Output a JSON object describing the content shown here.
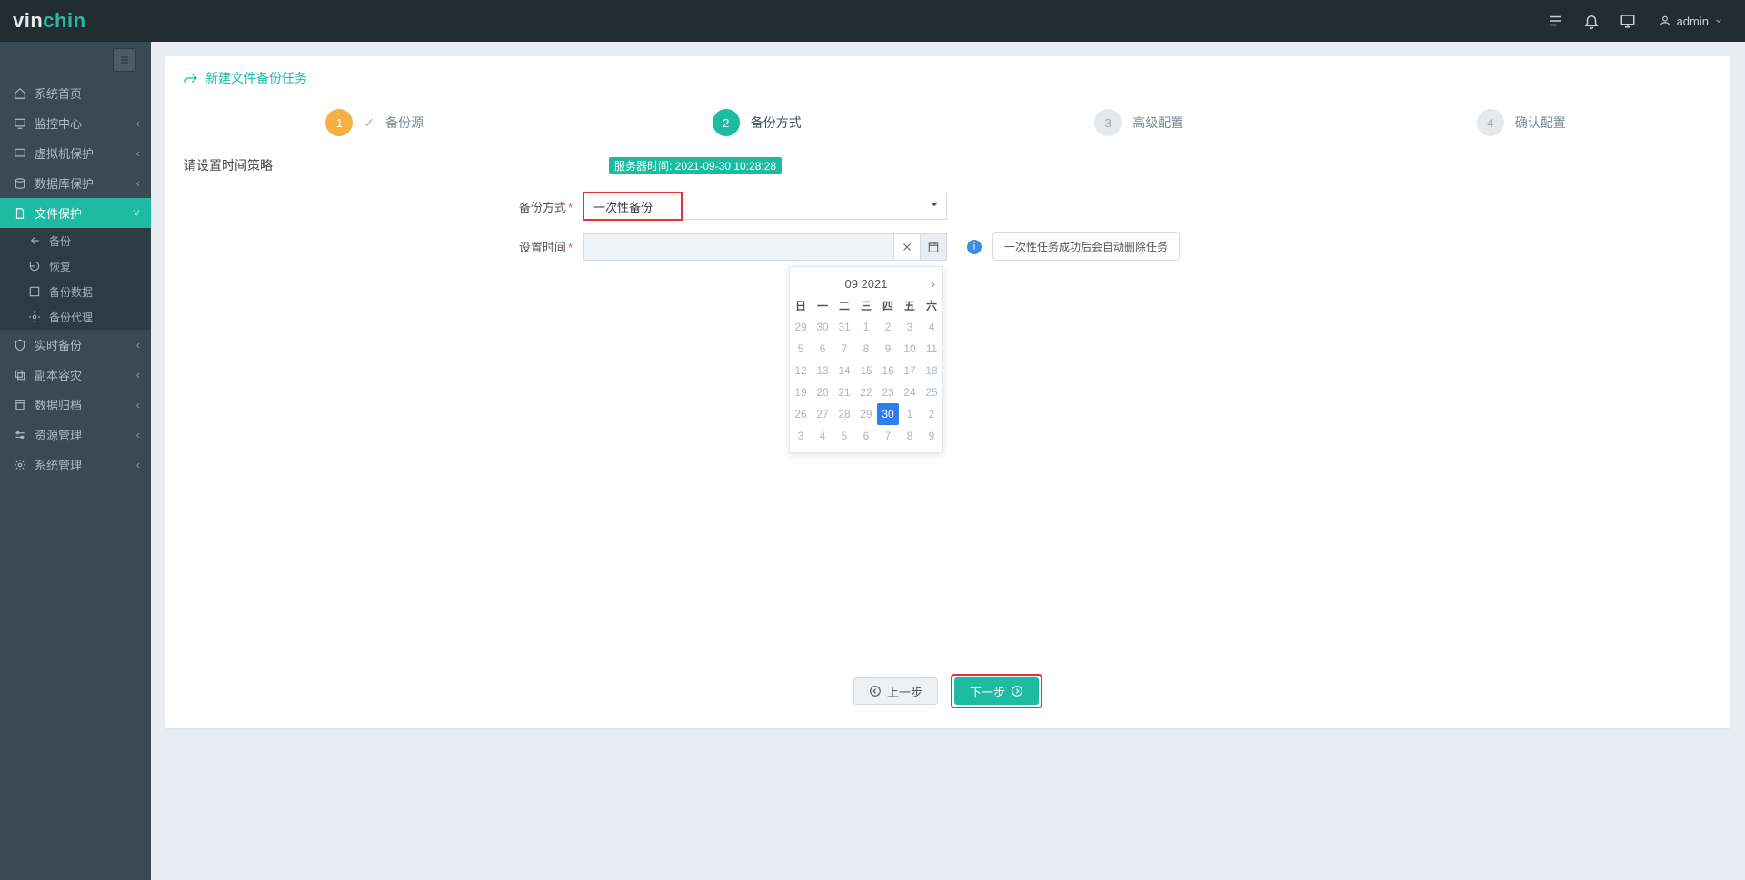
{
  "brand": {
    "pre": "vin",
    "post": "chin"
  },
  "top_user": "admin",
  "sidebar": {
    "items": [
      {
        "label": "系统首页",
        "icon": "home",
        "expandable": false
      },
      {
        "label": "监控中心",
        "icon": "monitor",
        "expandable": true
      },
      {
        "label": "虚拟机保护",
        "icon": "vm",
        "expandable": true
      },
      {
        "label": "数据库保护",
        "icon": "db",
        "expandable": true
      },
      {
        "label": "文件保护",
        "icon": "file",
        "expandable": true,
        "active": true,
        "children": [
          {
            "label": "备份",
            "icon": "share"
          },
          {
            "label": "恢复",
            "icon": "recover"
          },
          {
            "label": "备份数据",
            "icon": "data"
          },
          {
            "label": "备份代理",
            "icon": "agent"
          }
        ]
      },
      {
        "label": "实时备份",
        "icon": "shield",
        "expandable": true
      },
      {
        "label": "副本容灾",
        "icon": "copy",
        "expandable": true
      },
      {
        "label": "数据归档",
        "icon": "archive",
        "expandable": true
      },
      {
        "label": "资源管理",
        "icon": "sliders",
        "expandable": true
      },
      {
        "label": "系统管理",
        "icon": "gear",
        "expandable": true
      }
    ]
  },
  "card_title": "新建文件备份任务",
  "wizard": {
    "steps": [
      {
        "num": "1",
        "label": "备份源",
        "state": "done",
        "check": true
      },
      {
        "num": "2",
        "label": "备份方式",
        "state": "current"
      },
      {
        "num": "3",
        "label": "高级配置",
        "state": "future"
      },
      {
        "num": "4",
        "label": "确认配置",
        "state": "future"
      }
    ]
  },
  "form": {
    "section_title": "请设置时间策略",
    "server_time_label": "服务器时间: 2021-09-30 10:28:28",
    "backup_mode_label": "备份方式",
    "backup_mode_value": "一次性备份",
    "set_time_label": "设置时间",
    "date_value": "",
    "tip_text": "一次性任务成功后会自动删除任务"
  },
  "datepicker": {
    "title": "09 2021",
    "dow": [
      "日",
      "一",
      "二",
      "三",
      "四",
      "五",
      "六"
    ],
    "weeks": [
      [
        "29",
        "30",
        "31",
        "1",
        "2",
        "3",
        "4"
      ],
      [
        "5",
        "6",
        "7",
        "8",
        "9",
        "10",
        "11"
      ],
      [
        "12",
        "13",
        "14",
        "15",
        "16",
        "17",
        "18"
      ],
      [
        "19",
        "20",
        "21",
        "22",
        "23",
        "24",
        "25"
      ],
      [
        "26",
        "27",
        "28",
        "29",
        "30",
        "1",
        "2"
      ],
      [
        "3",
        "4",
        "5",
        "6",
        "7",
        "8",
        "9"
      ]
    ],
    "selected": {
      "week": 4,
      "col": 4
    }
  },
  "footer": {
    "prev": "上一步",
    "next": "下一步"
  },
  "chart_data": null
}
